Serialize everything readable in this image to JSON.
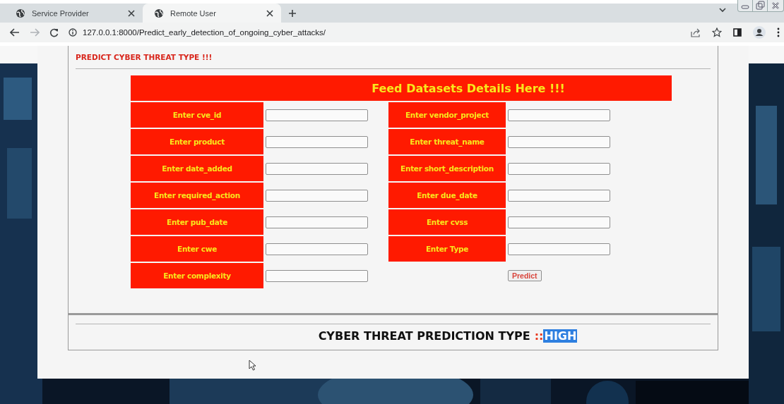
{
  "browser": {
    "tabs": [
      {
        "title": "Service Provider",
        "selected": false
      },
      {
        "title": "Remote User",
        "selected": true
      }
    ],
    "nav": {
      "back_enabled": true,
      "forward_enabled": false
    },
    "address": "127.0.0.1:8000/Predict_early_detection_of_ongoing_cyber_attacks/"
  },
  "page": {
    "heading": "PREDICT CYBER THREAT TYPE !!!",
    "form": {
      "title": "Feed Datasets Details Here !!!",
      "rows": [
        {
          "left": {
            "label": "Enter cve_id"
          },
          "right": {
            "label": "Enter vendor_project"
          }
        },
        {
          "left": {
            "label": "Enter product"
          },
          "right": {
            "label": "Enter threat_name"
          }
        },
        {
          "left": {
            "label": "Enter date_added"
          },
          "right": {
            "label": "Enter short_description"
          }
        },
        {
          "left": {
            "label": "Enter required_action"
          },
          "right": {
            "label": "Enter due_date"
          }
        },
        {
          "left": {
            "label": "Enter pub_date"
          },
          "right": {
            "label": "Enter cvss"
          }
        },
        {
          "left": {
            "label": "Enter cwe"
          },
          "right": {
            "label": "Enter Type"
          }
        },
        {
          "left": {
            "label": "Enter complexity"
          }
        }
      ],
      "submit": "Predict"
    },
    "result": {
      "label": "CYBER THREAT PREDICTION TYPE",
      "separator": "::",
      "value": "HIGH",
      "highlighted": true
    }
  }
}
